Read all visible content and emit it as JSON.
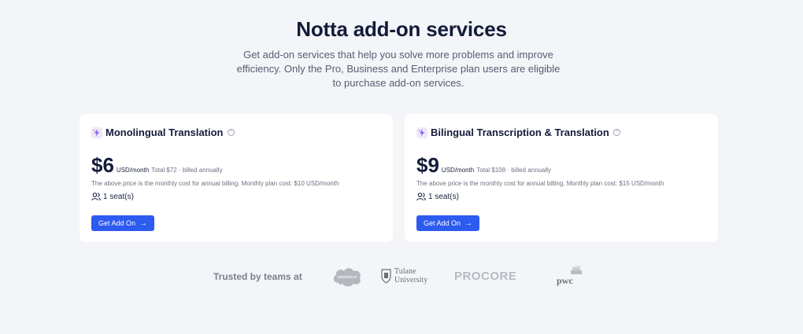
{
  "header": {
    "title": "Notta add-on services",
    "subtitle": "Get add-on services that help you solve more problems and improve efficiency. Only the Pro, Business and Enterprise plan users are eligible to purchase add-on services."
  },
  "cards": [
    {
      "title": "Monolingual Translation",
      "price": "$6",
      "unit": "USD/month",
      "total": "Total $72 · billed annually",
      "note": "The above price is the monthly cost for annual billing. Monthly plan cost: $10 USD/month",
      "seats": "1 seat(s)",
      "button": "Get Add On"
    },
    {
      "title": "Bilingual Transcription & Translation",
      "price": "$9",
      "unit": "USD/month",
      "total": "Total $108 · billed annually",
      "note": "The above price is the monthly cost for annual billing. Monthly plan cost: $15 USD/month",
      "seats": "1 seat(s)",
      "button": "Get Add On"
    }
  ],
  "trusted": {
    "label": "Trusted by teams at",
    "logos": [
      {
        "name": "salesforce",
        "text": "salesforce"
      },
      {
        "name": "tulane",
        "text_line1": "Tulane",
        "text_line2": "University"
      },
      {
        "name": "procore",
        "text": "PROCORE"
      },
      {
        "name": "pwc",
        "text": "pwc"
      }
    ]
  },
  "colors": {
    "background": "#f4f5f8",
    "card": "#ffffff",
    "primary_button": "#2d5bf0",
    "heading": "#141b3a"
  },
  "icons": [
    "addon-sparkle-icon",
    "help-circle-icon",
    "users-icon",
    "arrow-right-icon"
  ]
}
